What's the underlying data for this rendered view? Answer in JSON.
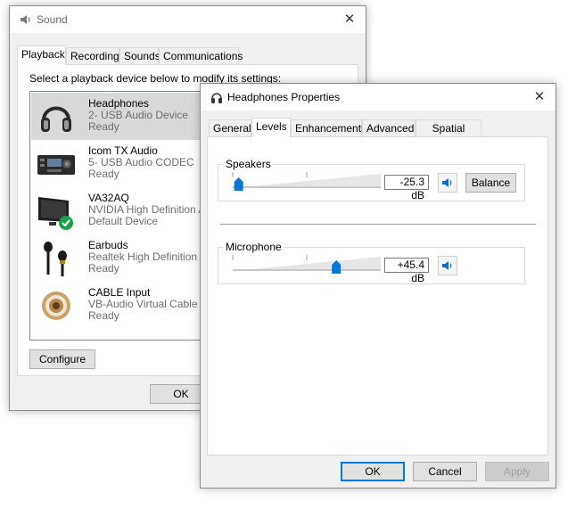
{
  "sound_window": {
    "title": "Sound",
    "close": "✕",
    "tabs": [
      "Playback",
      "Recording",
      "Sounds",
      "Communications"
    ],
    "instruction": "Select a playback device below to modify its settings:",
    "devices": [
      {
        "name": "Headphones",
        "sub": "2- USB Audio Device",
        "status": "Ready",
        "icon": "headphones-icon"
      },
      {
        "name": "Icom TX Audio",
        "sub": "5- USB Audio CODEC",
        "status": "Ready",
        "icon": "radio-transceiver-icon"
      },
      {
        "name": "VA32AQ",
        "sub": "NVIDIA High Definition A",
        "status": "Default Device",
        "icon": "monitor-icon"
      },
      {
        "name": "Earbuds",
        "sub": "Realtek High Definition A",
        "status": "Ready",
        "icon": "earbuds-icon"
      },
      {
        "name": "CABLE Input",
        "sub": "VB-Audio Virtual Cable",
        "status": "Ready",
        "icon": "rca-cable-icon"
      }
    ],
    "configure_label": "Configure",
    "ok_label": "OK"
  },
  "props_window": {
    "title": "Headphones Properties",
    "close": "✕",
    "tabs": [
      "General",
      "Levels",
      "Enhancements",
      "Advanced",
      "Spatial sound"
    ],
    "active_tab": "Levels",
    "speakers": {
      "label": "Speakers",
      "value_text": "-25.3 dB",
      "level": 0.04
    },
    "balance_label": "Balance",
    "microphone": {
      "label": "Microphone",
      "value_text": "+45.4 dB",
      "level": 0.7
    },
    "ok_label": "OK",
    "cancel_label": "Cancel",
    "apply_label": "Apply"
  },
  "colors": {
    "accent": "#0078d7",
    "selection": "#d9d9d9",
    "check_green": "#16a34a"
  }
}
